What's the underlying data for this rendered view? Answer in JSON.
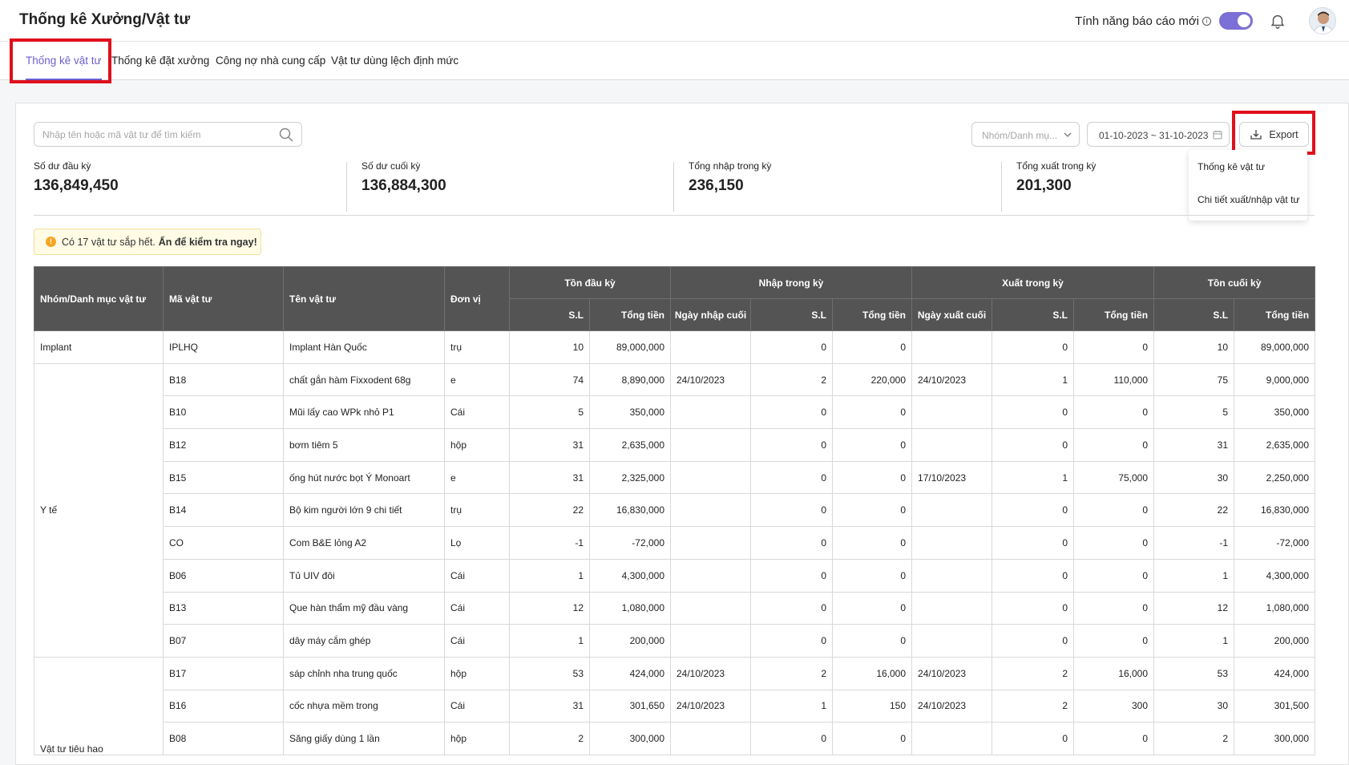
{
  "header": {
    "title": "Thống kê Xưởng/Vật tư",
    "feature_label": "Tính năng báo cáo mới",
    "toggle_on": true
  },
  "tabs": [
    {
      "label": "Thống kê vật tư",
      "active": true
    },
    {
      "label": "Thống kê đặt xưởng",
      "active": false
    },
    {
      "label": "Công nợ nhà cung cấp",
      "active": false
    },
    {
      "label": "Vật tư dùng lệch định mức",
      "active": false
    }
  ],
  "filters": {
    "search_placeholder": "Nhập tên hoặc mã vật tư để tìm kiếm",
    "group_placeholder": "Nhóm/Danh mụ...",
    "date_range": "01-10-2023  ~  31-10-2023",
    "export_label": "Export",
    "export_menu": [
      "Thống kê vật tư",
      "Chi tiết xuất/nhập vật tư"
    ]
  },
  "stats": [
    {
      "label": "Số dư đầu kỳ",
      "value": "136,849,450"
    },
    {
      "label": "Số dư cuối kỳ",
      "value": "136,884,300"
    },
    {
      "label": "Tổng nhập trong kỳ",
      "value": "236,150"
    },
    {
      "label": "Tổng xuất trong kỳ",
      "value": "201,300"
    }
  ],
  "alert": {
    "text": "Có 17 vật tư sắp hết.",
    "action": "Ấn để kiểm tra ngay!"
  },
  "table": {
    "headers": {
      "group": "Nhóm/Danh mục vật tư",
      "code": "Mã vật tư",
      "name": "Tên vật tư",
      "unit": "Đơn vị",
      "opening": "Tồn đầu kỳ",
      "import": "Nhập trong kỳ",
      "export": "Xuất trong kỳ",
      "closing": "Tồn cuối kỳ",
      "qty": "S.L",
      "total": "Tổng tiền",
      "last_import": "Ngày nhập cuối",
      "last_export": "Ngày xuất cuối"
    },
    "groups": [
      {
        "name": "Implant",
        "rows": 1
      },
      {
        "name": "Y tế",
        "rows": 9
      },
      {
        "name": "Vật tư tiêu hao",
        "rows": 3
      }
    ],
    "rows": [
      [
        "IPLHQ",
        "Implant Hàn Quốc",
        "trụ",
        "10",
        "89,000,000",
        "",
        "0",
        "0",
        "",
        "0",
        "0",
        "10",
        "89,000,000"
      ],
      [
        "B18",
        "chất gắn hàm Fixxodent 68g",
        "e",
        "74",
        "8,890,000",
        "24/10/2023",
        "2",
        "220,000",
        "24/10/2023",
        "1",
        "110,000",
        "75",
        "9,000,000"
      ],
      [
        "B10",
        "Mũi lấy cao WPk nhỏ P1",
        "Cái",
        "5",
        "350,000",
        "",
        "0",
        "0",
        "",
        "0",
        "0",
        "5",
        "350,000"
      ],
      [
        "B12",
        "bơm tiêm 5",
        "hộp",
        "31",
        "2,635,000",
        "",
        "0",
        "0",
        "",
        "0",
        "0",
        "31",
        "2,635,000"
      ],
      [
        "B15",
        "ống hút nước bọt Ý Monoart",
        "e",
        "31",
        "2,325,000",
        "",
        "0",
        "0",
        "17/10/2023",
        "1",
        "75,000",
        "30",
        "2,250,000"
      ],
      [
        "B14",
        "Bộ kim người lớn 9 chi tiết",
        "trụ",
        "22",
        "16,830,000",
        "",
        "0",
        "0",
        "",
        "0",
        "0",
        "22",
        "16,830,000"
      ],
      [
        "CO",
        "Com B&E lỏng A2",
        "Lọ",
        "-1",
        "-72,000",
        "",
        "0",
        "0",
        "",
        "0",
        "0",
        "-1",
        "-72,000"
      ],
      [
        "B06",
        "Tủ UIV đôi",
        "Cái",
        "1",
        "4,300,000",
        "",
        "0",
        "0",
        "",
        "0",
        "0",
        "1",
        "4,300,000"
      ],
      [
        "B13",
        "Que hàn thẩm mỹ đầu vàng",
        "Cái",
        "12",
        "1,080,000",
        "",
        "0",
        "0",
        "",
        "0",
        "0",
        "12",
        "1,080,000"
      ],
      [
        "B07",
        "dây máy cắm ghép",
        "Cái",
        "1",
        "200,000",
        "",
        "0",
        "0",
        "",
        "0",
        "0",
        "1",
        "200,000"
      ],
      [
        "B17",
        "sáp chỉnh nha trung quốc",
        "hộp",
        "53",
        "424,000",
        "24/10/2023",
        "2",
        "16,000",
        "24/10/2023",
        "2",
        "16,000",
        "53",
        "424,000"
      ],
      [
        "B16",
        "cốc nhựa mềm trong",
        "Cái",
        "31",
        "301,650",
        "24/10/2023",
        "1",
        "150",
        "24/10/2023",
        "2",
        "300",
        "30",
        "301,500"
      ],
      [
        "B08",
        "Săng giấy dùng 1 lần",
        "hộp",
        "2",
        "300,000",
        "",
        "0",
        "0",
        "",
        "0",
        "0",
        "2",
        "300,000"
      ]
    ]
  }
}
